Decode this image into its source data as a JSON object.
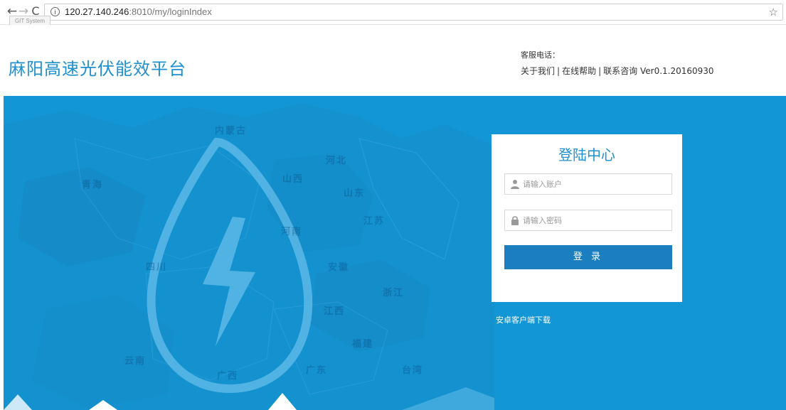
{
  "browser": {
    "back": "←",
    "forward": "→",
    "reload": "C",
    "info": "i",
    "url_host": "120.27.140.246",
    "url_rest": ":8010/my/loginIndex",
    "tooltip": "GIT System",
    "star": "☆"
  },
  "header": {
    "title": "麻阳高速光伏能效平台",
    "service_label": "客服电话：",
    "links": {
      "about": "关于我们",
      "help": "在线帮助",
      "contact": "联系咨询",
      "version": "Ver0.1.20160930",
      "separator": "|"
    }
  },
  "banner": {
    "background_color": "#1296d6",
    "map_labels": [
      "内蒙古",
      "青海",
      "河北",
      "山西",
      "山东",
      "江苏",
      "河南",
      "四川",
      "安徽",
      "浙江",
      "江西",
      "福建",
      "云南",
      "广东",
      "广西",
      "台湾"
    ]
  },
  "login": {
    "title": "登陆中心",
    "account_placeholder": "请输入账户",
    "password_placeholder": "请输入密码",
    "submit_label": "登 录",
    "android_download": "安卓客户端下载"
  },
  "colors": {
    "brand_blue": "#1e8fcf",
    "button_blue": "#1b7fbf"
  }
}
